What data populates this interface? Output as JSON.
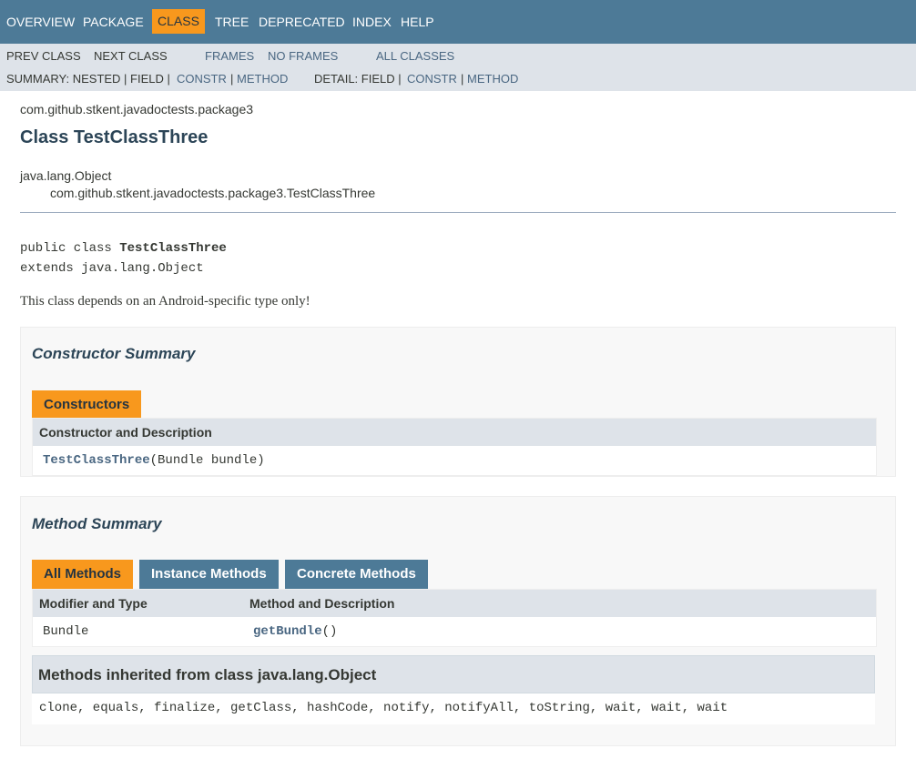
{
  "topnav": {
    "items": [
      "OVERVIEW",
      "PACKAGE",
      "CLASS",
      "TREE",
      "DEPRECATED",
      "INDEX",
      "HELP"
    ],
    "selected": "CLASS"
  },
  "subnav": {
    "prev_class": "PREV CLASS",
    "next_class": "NEXT CLASS",
    "frames": "FRAMES",
    "no_frames": "NO FRAMES",
    "all_classes": "ALL CLASSES",
    "summary_prefix": "SUMMARY: NESTED | FIELD |",
    "summary_constr": "CONSTR",
    "summary_sep": "|",
    "summary_method": "METHOD",
    "detail_prefix": "DETAIL: FIELD |",
    "detail_constr": "CONSTR",
    "detail_sep": "|",
    "detail_method": "METHOD"
  },
  "header": {
    "package": "com.github.stkent.javadoctests.package3",
    "title": "Class TestClassThree"
  },
  "inheritance": {
    "root": "java.lang.Object",
    "child": "com.github.stkent.javadoctests.package3.TestClassThree"
  },
  "declaration": {
    "line1_prefix": "public class ",
    "line1_name": "TestClassThree",
    "line2": "extends java.lang.Object"
  },
  "description": "This class depends on an Android-specific type only!",
  "constructor_summary": {
    "title": "Constructor Summary",
    "tab": "Constructors",
    "column": "Constructor and Description",
    "rows": [
      {
        "name": "TestClassThree",
        "params": "(Bundle bundle)"
      }
    ]
  },
  "method_summary": {
    "title": "Method Summary",
    "tabs": [
      "All Methods",
      "Instance Methods",
      "Concrete Methods"
    ],
    "active_tab": "All Methods",
    "columns": [
      "Modifier and Type",
      "Method and Description"
    ],
    "rows": [
      {
        "type": "Bundle",
        "name": "getBundle",
        "params": "()"
      }
    ],
    "inherited_title": "Methods inherited from class java.lang.Object",
    "inherited_methods": "clone, equals, finalize, getClass, hashCode, notify, notifyAll, toString, wait, wait, wait"
  },
  "colors": {
    "nav_bg": "#4d7a97",
    "subnav_bg": "#dee3e9",
    "accent": "#f8981d",
    "link": "#4a6782"
  }
}
